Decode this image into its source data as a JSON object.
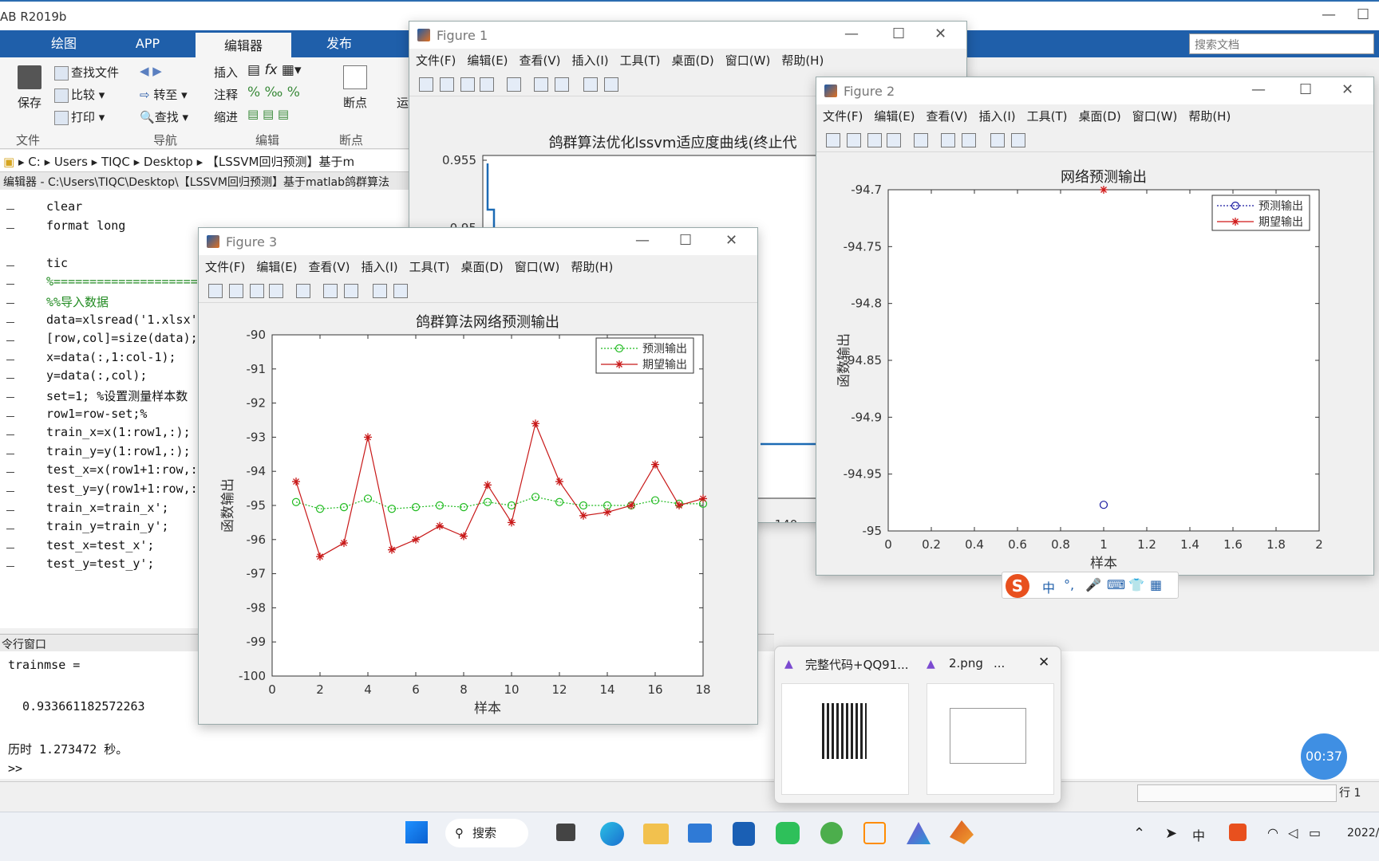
{
  "app": {
    "title": "AB R2019b"
  },
  "ribbon": {
    "tabs": [
      "绘图",
      "APP",
      "编辑器",
      "发布"
    ],
    "buttons": {
      "save": "保存",
      "find_file": "查找文件",
      "compare": "比较",
      "print": "打印",
      "goto": "转至",
      "find": "查找",
      "insert": "插入",
      "comment": "注释",
      "indent": "缩进",
      "breakpoint": "断点",
      "run": "运"
    },
    "groups": [
      "文件",
      "导航",
      "编辑",
      "断点"
    ],
    "search_placeholder": "搜索文档"
  },
  "address": {
    "parts": [
      "C:",
      "Users",
      "TIQC",
      "Desktop",
      "【LSSVM回归预测】基于m"
    ]
  },
  "editor": {
    "title": "编辑器 - C:\\Users\\TIQC\\Desktop\\【LSSVM回归预测】基于matlab鸽群算法",
    "lines": [
      "clear",
      "format long",
      "",
      "tic",
      "%====================",
      "%%导入数据",
      "data=xlsread('1.xlsx'",
      "[row,col]=size(data);",
      "x=data(:,1:col-1);",
      "y=data(:,col);",
      "set=1; %设置测量样本数",
      "row1=row-set;%",
      "train_x=x(1:row1,:);",
      "train_y=y(1:row1,:);",
      "test_x=x(row1+1:row,:",
      "test_y=y(row1+1:row,:",
      "train_x=train_x';",
      "train_y=train_y';",
      "test_x=test_x';",
      "test_y=test_y';"
    ]
  },
  "command": {
    "title": "令行窗口",
    "lines": [
      "trainmse =",
      "",
      "  0.933661182572263",
      "",
      "历时 1.273472 秒。",
      ">>"
    ]
  },
  "status": {
    "row_label": "行 1"
  },
  "menus": [
    "文件(F)",
    "编辑(E)",
    "查看(V)",
    "插入(I)",
    "工具(T)",
    "桌面(D)",
    "窗口(W)",
    "帮助(H)"
  ],
  "figures": {
    "f1": {
      "name": "Figure 1"
    },
    "f2": {
      "name": "Figure 2"
    },
    "f3": {
      "name": "Figure 3"
    }
  },
  "chart_data": [
    {
      "type": "line",
      "title": "鸽群算法优化lssvm适应度曲线(终止代",
      "yticks": [
        0.955,
        0.95
      ],
      "xticks": [
        140
      ],
      "series": [
        {
          "values": "step curve from ~0.954 down to ~0.947"
        }
      ]
    },
    {
      "type": "scatter",
      "title": "网络预测输出",
      "xlabel": "样本",
      "ylabel": "函数输出",
      "xlim": [
        0,
        2
      ],
      "ylim": [
        -95,
        -94.7
      ],
      "xticks": [
        0,
        0.2,
        0.4,
        0.6,
        0.8,
        1,
        1.2,
        1.4,
        1.6,
        1.8,
        2
      ],
      "yticks": [
        -94.7,
        -94.75,
        -94.8,
        -94.85,
        -94.9,
        -94.95,
        -95
      ],
      "legend": "top-right",
      "series": [
        {
          "name": "预测输出",
          "color": "#1a1aa0",
          "x": [
            1
          ],
          "y": [
            -94.977
          ]
        },
        {
          "name": "期望输出",
          "color": "#d01818",
          "x": [
            1
          ],
          "y": [
            -94.7
          ]
        }
      ]
    },
    {
      "type": "line",
      "title": "鸽群算法网络预测输出",
      "xlabel": "样本",
      "ylabel": "函数输出",
      "xlim": [
        0,
        18
      ],
      "ylim": [
        -100,
        -90
      ],
      "xticks": [
        0,
        2,
        4,
        6,
        8,
        10,
        12,
        14,
        16,
        18
      ],
      "yticks": [
        -90,
        -91,
        -92,
        -93,
        -94,
        -95,
        -96,
        -97,
        -98,
        -99,
        -100
      ],
      "legend": "top-right",
      "x": [
        1,
        2,
        3,
        4,
        5,
        6,
        7,
        8,
        9,
        10,
        11,
        12,
        13,
        14,
        15,
        16,
        17,
        18
      ],
      "series": [
        {
          "name": "预测输出",
          "color": "#22bb22",
          "values": [
            -94.9,
            -95.1,
            -95.05,
            -94.8,
            -95.1,
            -95.05,
            -95.0,
            -95.05,
            -94.9,
            -95.0,
            -94.75,
            -94.9,
            -95.0,
            -95.0,
            -95.0,
            -94.85,
            -94.95,
            -94.95
          ]
        },
        {
          "name": "期望输出",
          "color": "#c81818",
          "values": [
            -94.3,
            -96.5,
            -96.1,
            -93.0,
            -96.3,
            -96.0,
            -95.6,
            -95.9,
            -94.4,
            -95.5,
            -92.6,
            -94.3,
            -95.3,
            -95.2,
            -95.0,
            -93.8,
            -95.0,
            -94.8
          ]
        }
      ]
    }
  ],
  "ime": {
    "items": [
      "中",
      "°,",
      "🎤",
      "⌨",
      "👕",
      "▦"
    ]
  },
  "thumbnails": {
    "t1": "完整代码+QQ91...",
    "t2": "2.png"
  },
  "timer": "00:37",
  "taskbar": {
    "search": "搜索",
    "clock": "2022/"
  }
}
